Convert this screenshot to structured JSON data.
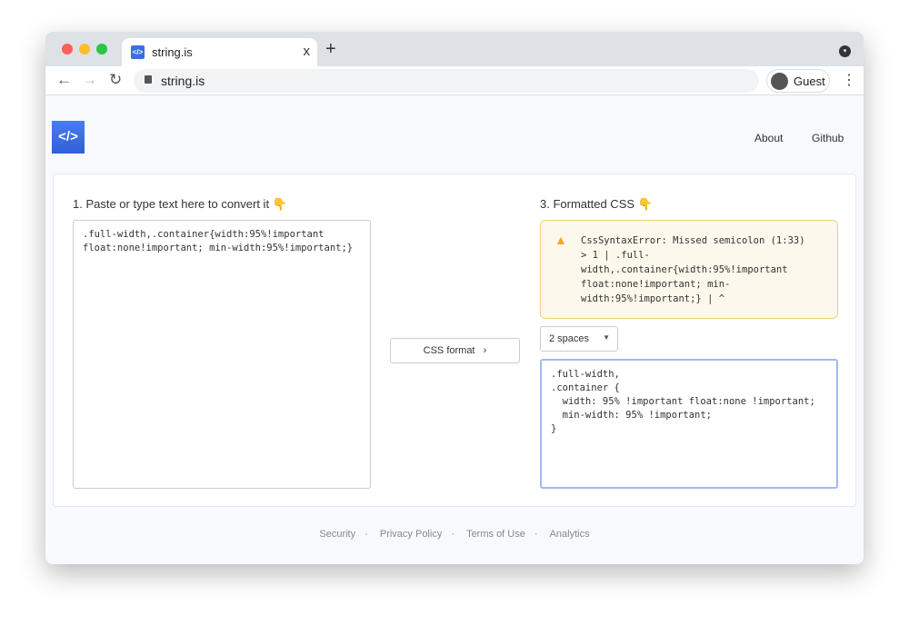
{
  "browser": {
    "tab_title": "string.is",
    "url": "string.is",
    "profile": "Guest",
    "new_tab": "+",
    "close": "x"
  },
  "header": {
    "logo": "</>",
    "links": [
      "About",
      "Github"
    ]
  },
  "input": {
    "label": "1. Paste or type text here to convert it 👇",
    "value": ".full-width,.container{width:95%!important\nfloat:none!important; min-width:95%!important;}"
  },
  "convert_button": {
    "label": "CSS format",
    "icon": "›"
  },
  "output": {
    "label": "3. Formatted CSS 👇",
    "error": "CssSyntaxError: Missed semicolon (1:33)\n> 1 | .full-\nwidth,.container{width:95%!important\nfloat:none!important; min-\nwidth:95%!important;} | ^",
    "indent": "2 spaces",
    "value": ".full-width,\n.container {\n  width: 95% !important float:none !important;\n  min-width: 95% !important;\n}"
  },
  "footer": {
    "links": [
      "Security",
      "Privacy Policy",
      "Terms of Use",
      "Analytics"
    ],
    "sep": "·"
  }
}
